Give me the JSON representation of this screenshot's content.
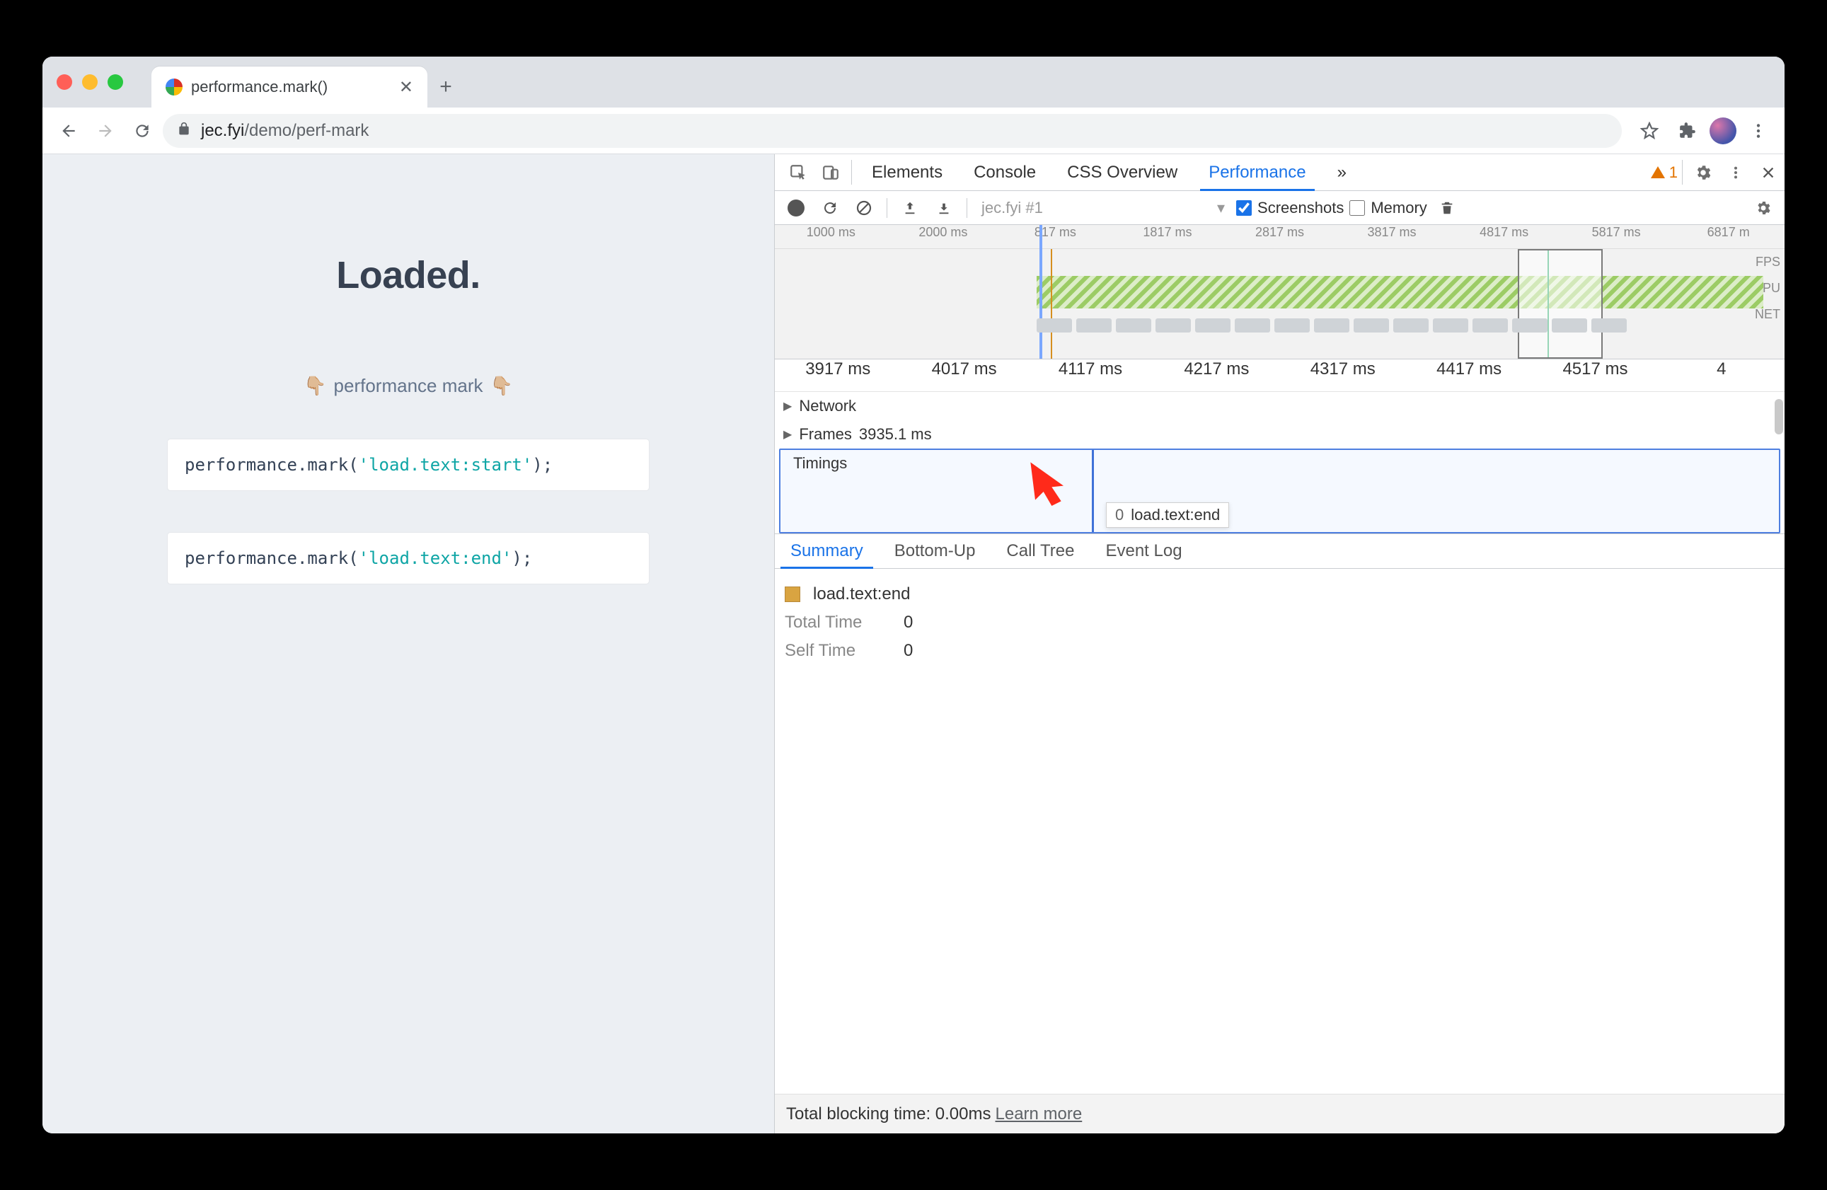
{
  "browser": {
    "tab_title": "performance.mark()",
    "url_host": "jec.fyi",
    "url_path": "/demo/perf-mark"
  },
  "page": {
    "heading": "Loaded.",
    "subtitle": "performance mark",
    "pointer_emoji": "👇🏼",
    "code1_pre": "performance.mark(",
    "code1_str": "'load.text:start'",
    "code1_post": ");",
    "code2_pre": "performance.mark(",
    "code2_str": "'load.text:end'",
    "code2_post": ");"
  },
  "devtools": {
    "tabs": [
      "Elements",
      "Console",
      "CSS Overview",
      "Performance"
    ],
    "more_glyph": "»",
    "warn_count": "1"
  },
  "perf_bar": {
    "recording_label": "jec.fyi #1",
    "screenshots": "Screenshots",
    "screenshots_checked": true,
    "memory": "Memory",
    "memory_checked": false
  },
  "overview_ruler": [
    "1000 ms",
    "2000 ms",
    "817 ms",
    "1817 ms",
    "2817 ms",
    "3817 ms",
    "4817 ms",
    "5817 ms",
    "6817 m"
  ],
  "overview_side": [
    "FPS",
    "CPU",
    "NET"
  ],
  "main_ruler": [
    "3917 ms",
    "4017 ms",
    "4117 ms",
    "4217 ms",
    "4317 ms",
    "4417 ms",
    "4517 ms",
    "4"
  ],
  "tracks": {
    "network": "Network",
    "frames": "Frames",
    "frames_value": "3935.1 ms",
    "timings": "Timings",
    "tooltip_num": "0",
    "tooltip_text": "load.text:end"
  },
  "detail_tabs": [
    "Summary",
    "Bottom-Up",
    "Call Tree",
    "Event Log"
  ],
  "summary": {
    "name": "load.text:end",
    "total_label": "Total Time",
    "total_val": "0",
    "self_label": "Self Time",
    "self_val": "0"
  },
  "footer": {
    "text": "Total blocking time: 0.00ms",
    "link": "Learn more"
  }
}
